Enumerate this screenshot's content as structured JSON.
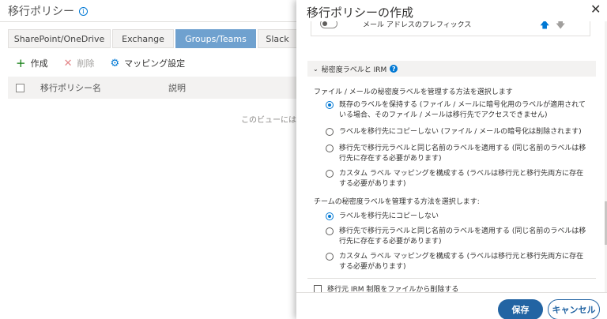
{
  "background": {
    "title": "移行ポリシー",
    "tabs": [
      {
        "label": "SharePoint/OneDrive",
        "active": false
      },
      {
        "label": "Exchange",
        "active": false
      },
      {
        "label": "Groups/Teams",
        "active": true
      },
      {
        "label": "Slack",
        "active": false
      }
    ],
    "toolbar": {
      "create_label": "作成",
      "delete_label": "削除",
      "mapping_label": "マッピング設定"
    },
    "table": {
      "columns": [
        "移行ポリシー名",
        "説明"
      ],
      "empty_text": "このビューには表示す"
    }
  },
  "panel": {
    "title": "移行ポリシーの作成",
    "close_icon": "close-icon",
    "prefix": {
      "label": "メール アドレスのプレフィックス",
      "toggle_on": false
    },
    "section": {
      "title": "秘密度ラベルと IRM",
      "file_question": "ファイル / メールの秘密度ラベルを管理する方法を選択します",
      "file_options": [
        {
          "text": "既存のラベルを保持する (ファイル / メールに暗号化用のラベルが適用されている場合、そのファイル / メールは移行先でアクセスできません)",
          "selected": true
        },
        {
          "text": "ラベルを移行先にコピーしない (ファイル / メールの暗号化は削除されます)",
          "selected": false
        },
        {
          "text": "移行先で移行元ラベルと同じ名前のラベルを適用する (同じ名前のラベルは移行先に存在する必要があります)",
          "selected": false
        },
        {
          "text": "カスタム ラベル マッピングを構成する (ラベルは移行元と移行先両方に存在する必要があります)",
          "selected": false
        }
      ],
      "team_question": "チームの秘密度ラベルを管理する方法を選択します:",
      "team_options": [
        {
          "text": "ラベルを移行先にコピーしない",
          "selected": true
        },
        {
          "text": "移行先で移行元ラベルと同じ名前のラベルを適用する (同じ名前のラベルは移行先に存在する必要があります)",
          "selected": false
        },
        {
          "text": "カスタム ラベル マッピングを構成する (ラベルは移行元と移行先両方に存在する必要があります)",
          "selected": false
        }
      ],
      "irm_label": "移行元 IRM 制限をファイルから削除する",
      "irm_checked": false
    },
    "footer": {
      "save_label": "保存",
      "cancel_label": "キャンセル"
    },
    "colors": {
      "accent": "#0078d4",
      "primary_button": "#2264a3",
      "active_tab": "#6fa1cf"
    }
  }
}
